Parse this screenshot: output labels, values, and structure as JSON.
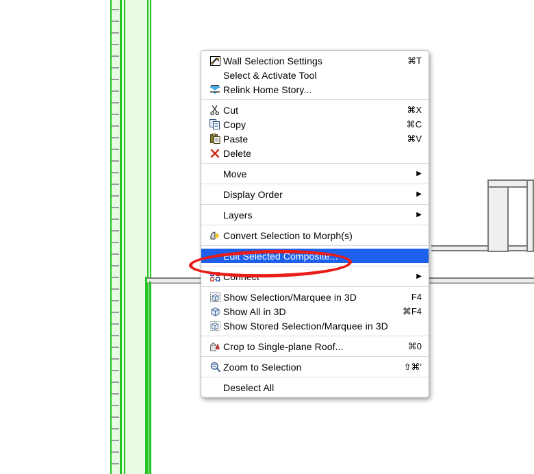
{
  "app": {
    "context": "architectural-cad-floor-plan",
    "canvas_background": "#ffffff"
  },
  "colors": {
    "selection_highlight": "#1c60ec",
    "selected_wall_fill": "#e9fbe4",
    "selected_wall_outline": "#23c423",
    "wall_outline": "#7a7a7a",
    "wall_fill": "#efefef",
    "annotation_red": "#e81d19",
    "menu_background": "#ffffff",
    "menu_border": "#b3b3b3",
    "separator": "#d8d8d8"
  },
  "drawing": {
    "selected_wall_label": "selected-vertical-wall",
    "walls": [
      {
        "name": "vertical-selected-wall",
        "selected": true
      },
      {
        "name": "lower-horizontal-wall",
        "selected": false
      },
      {
        "name": "upper-horizontal-wall-right",
        "selected": false
      },
      {
        "name": "niche-wall-right",
        "selected": false
      }
    ]
  },
  "context_menu": {
    "groups": [
      {
        "items": [
          {
            "icon": "wall-settings-icon",
            "label": "Wall Selection Settings",
            "shortcut": "⌘T",
            "submenu": false,
            "highlight": false
          },
          {
            "icon": "",
            "label": "Select & Activate Tool",
            "shortcut": "",
            "submenu": false,
            "highlight": false
          },
          {
            "icon": "relink-story-icon",
            "label": "Relink Home Story...",
            "shortcut": "",
            "submenu": false,
            "highlight": false
          }
        ]
      },
      {
        "items": [
          {
            "icon": "scissors-icon",
            "label": "Cut",
            "shortcut": "⌘X",
            "submenu": false,
            "highlight": false
          },
          {
            "icon": "copy-icon",
            "label": "Copy",
            "shortcut": "⌘C",
            "submenu": false,
            "highlight": false
          },
          {
            "icon": "paste-icon",
            "label": "Paste",
            "shortcut": "⌘V",
            "submenu": false,
            "highlight": false
          },
          {
            "icon": "delete-x-icon",
            "label": "Delete",
            "shortcut": "",
            "submenu": false,
            "highlight": false
          }
        ]
      },
      {
        "items": [
          {
            "icon": "",
            "label": "Move",
            "shortcut": "",
            "submenu": true,
            "highlight": false
          }
        ]
      },
      {
        "items": [
          {
            "icon": "",
            "label": "Display Order",
            "shortcut": "",
            "submenu": true,
            "highlight": false
          }
        ]
      },
      {
        "items": [
          {
            "icon": "",
            "label": "Layers",
            "shortcut": "",
            "submenu": true,
            "highlight": false
          }
        ]
      },
      {
        "items": [
          {
            "icon": "morph-icon",
            "label": "Convert Selection to Morph(s)",
            "shortcut": "",
            "submenu": false,
            "highlight": false
          }
        ]
      },
      {
        "items": [
          {
            "icon": "",
            "label": "Edit Selected Composite...",
            "shortcut": "",
            "submenu": false,
            "highlight": true
          }
        ]
      },
      {
        "items": [
          {
            "icon": "connect-icon",
            "label": "Connect",
            "shortcut": "",
            "submenu": true,
            "highlight": false
          }
        ]
      },
      {
        "items": [
          {
            "icon": "show-selection-3d-icon",
            "label": "Show Selection/Marquee in 3D",
            "shortcut": "F4",
            "submenu": false,
            "highlight": false
          },
          {
            "icon": "show-all-3d-icon",
            "label": "Show All in 3D",
            "shortcut": "⌘F4",
            "submenu": false,
            "highlight": false
          },
          {
            "icon": "show-stored-3d-icon",
            "label": "Show Stored Selection/Marquee in 3D",
            "shortcut": "",
            "submenu": false,
            "highlight": false
          }
        ]
      },
      {
        "items": [
          {
            "icon": "crop-roof-icon",
            "label": "Crop to Single-plane Roof...",
            "shortcut": "⌘0",
            "submenu": false,
            "highlight": false
          }
        ]
      },
      {
        "items": [
          {
            "icon": "zoom-selection-icon",
            "label": "Zoom to Selection",
            "shortcut": "⇧⌘'",
            "submenu": false,
            "highlight": false
          }
        ]
      },
      {
        "items": [
          {
            "icon": "",
            "label": "Deselect All",
            "shortcut": "",
            "submenu": false,
            "highlight": false
          }
        ]
      }
    ],
    "submenu_arrow": "▶"
  },
  "annotation": {
    "type": "ellipse-highlight",
    "target_label": "Edit Selected Composite...",
    "color": "#e81d19"
  }
}
